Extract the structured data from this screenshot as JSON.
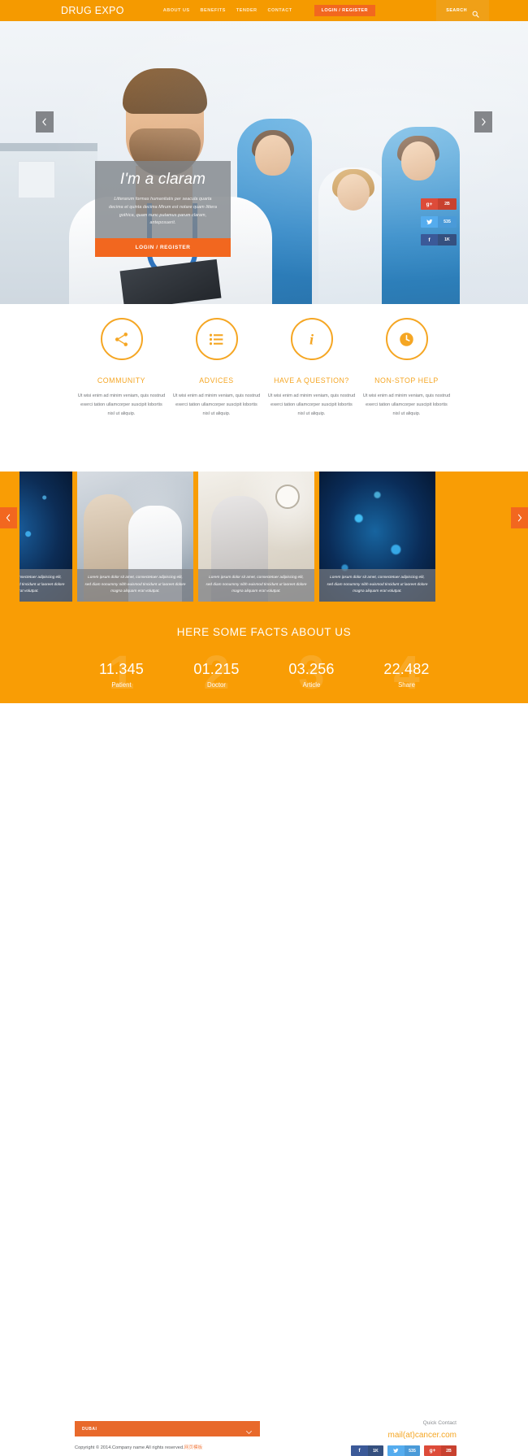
{
  "header": {
    "logo": "DRUG EXPO",
    "nav": [
      {
        "label": "ABOUT US"
      },
      {
        "label": "BENEFITS"
      },
      {
        "label": "TENDER"
      },
      {
        "label": "CONTACT"
      }
    ],
    "login_button": "LOGIN / REGISTER",
    "search_label": "SEARCH",
    "search_icon": "search-icon"
  },
  "hero": {
    "title": "I'm a claram",
    "description": "Litterarum formas humanitatis per seacula quarta decima et quinta decima Mirum est notare quam littera gothica, quam nunc putamus parum claram, anteposuerit.",
    "cta": "LOGIN / REGISTER",
    "prev_icon": "chevron-left-icon",
    "next_icon": "chevron-right-icon",
    "social": [
      {
        "network": "google-plus",
        "glyph": "g+",
        "count": "2B",
        "color": "#dd4b39"
      },
      {
        "network": "twitter",
        "glyph": "t",
        "count": "535",
        "color": "#55acee"
      },
      {
        "network": "facebook",
        "glyph": "f",
        "count": "1K",
        "color": "#3b5998"
      }
    ]
  },
  "features": [
    {
      "icon": "share-icon",
      "title": "COMMUNITY",
      "text": "Ut wisi enim ad minim veniam, quis nostrud exerci tation ullamcorper suscipit lobortis nisl ut aliquip."
    },
    {
      "icon": "list-icon",
      "title": "ADVICES",
      "text": "Ut wisi enim ad minim veniam, quis nostrud exerci tation ullamcorper suscipit lobortis nisl ut aliquip."
    },
    {
      "icon": "info-icon",
      "title": "HAVE A QUESTION?",
      "text": "Ut wisi enim ad minim veniam, quis nostrud exerci tation ullamcorper suscipit lobortis nisl ut aliquip."
    },
    {
      "icon": "clock-icon",
      "title": "NON-STOP HELP",
      "text": "Ut wisi enim ad minim veniam, quis nostrud exerci tation ullamcorper suscipit lobortis nisl ut aliquip."
    }
  ],
  "carousel": {
    "prev_icon": "chevron-left-icon",
    "next_icon": "chevron-right-icon",
    "caption": "Lorem ipsum dolor sit amet, consectetuer adipiscing elit, sed diam nonummy nibh euismod tincidunt ut laoreet dolore magna aliquam erat volutpat.",
    "slides": [
      {
        "art": "sl-neuro"
      },
      {
        "art": "sl-consult"
      },
      {
        "art": "sl-clinic"
      },
      {
        "art": "sl-virus"
      }
    ]
  },
  "facts": {
    "title": "HERE SOME FACTS ABOUT US",
    "items": [
      {
        "ghost": "1",
        "number": "11.345",
        "label": "Patient"
      },
      {
        "ghost": "2",
        "number": "01.215",
        "label": "Doctor"
      },
      {
        "ghost": "3",
        "number": "03.256",
        "label": "Article"
      },
      {
        "ghost": "4",
        "number": "22.482",
        "label": "Share"
      }
    ]
  },
  "footer": {
    "select_value": "DUBAI",
    "select_icon": "chevron-down-icon",
    "copyright": "Copyright © 2014.Company name All rights reserved.",
    "copyright_cn": "网页模板",
    "quick_contact": "Quick Contact",
    "email": "mail(at)cancer.com",
    "social": [
      {
        "network": "facebook",
        "glyph": "f",
        "count": "1K"
      },
      {
        "network": "twitter",
        "glyph": "t",
        "count": "535"
      },
      {
        "network": "google-plus",
        "glyph": "g+",
        "count": "2B"
      }
    ]
  },
  "theme": {
    "orange": "#f59a00",
    "orange_band": "#f99d05",
    "accent_orange": "#f2671f",
    "feature_orange": "#f5a623"
  }
}
